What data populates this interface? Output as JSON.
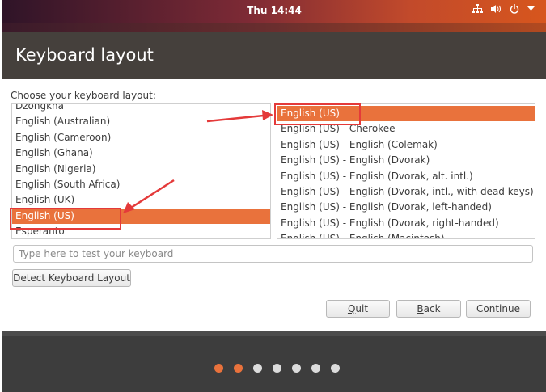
{
  "topbar": {
    "clock": "Thu 14:44",
    "icons": [
      "network-icon",
      "volume-icon",
      "power-icon",
      "chevron-down-icon"
    ]
  },
  "header": {
    "title": "Keyboard layout"
  },
  "main": {
    "choose_label": "Choose your keyboard layout:",
    "layouts": [
      "Dzongkha",
      "English (Australian)",
      "English (Cameroon)",
      "English (Ghana)",
      "English (Nigeria)",
      "English (South Africa)",
      "English (UK)",
      "English (US)",
      "Esperanto"
    ],
    "selected_layout": "English (US)",
    "variants": [
      "English (US)",
      "English (US) - Cherokee",
      "English (US) - English (Colemak)",
      "English (US) - English (Dvorak)",
      "English (US) - English (Dvorak, alt. intl.)",
      "English (US) - English (Dvorak, intl., with dead keys)",
      "English (US) - English (Dvorak, left-handed)",
      "English (US) - English (Dvorak, right-handed)",
      "English (US) - English (Macintosh)"
    ],
    "selected_variant": "English (US)",
    "test_placeholder": "Type here to test your keyboard",
    "detect_label": "Detect Keyboard Layout"
  },
  "actions": {
    "quit": "Quit",
    "back": "Back",
    "continue": "Continue"
  },
  "progress": {
    "total_steps": 7,
    "completed_steps": 2
  },
  "colors": {
    "accent": "#e9723c",
    "header_bg": "#45403c",
    "footer_bg": "#3d3d3d",
    "dot_active": "#e9723c",
    "dot_inactive": "#dcdcdc",
    "annotation": "#e43a3a"
  }
}
